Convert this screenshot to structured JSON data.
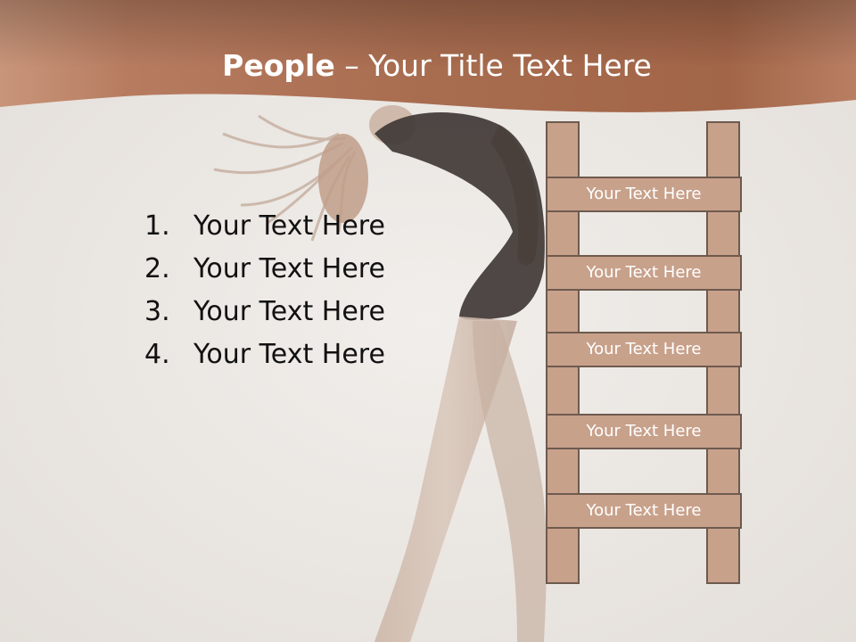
{
  "slide": {
    "title_bold": "People",
    "title_rest": " – Your Title Text Here"
  },
  "list": [
    {
      "number": "1.",
      "text": "Your Text Here"
    },
    {
      "number": "2.",
      "text": "Your Text Here"
    },
    {
      "number": "3.",
      "text": "Your Text Here"
    },
    {
      "number": "4.",
      "text": "Your Text Here"
    }
  ],
  "ladder": {
    "rungs": [
      "Your Text Here",
      "Your Text Here",
      "Your Text Here",
      "Your Text Here",
      "Your Text Here"
    ]
  },
  "colors": {
    "header": "#a86a4e",
    "ladder_fill": "#c8a18b",
    "ladder_border": "#6e5a4e",
    "background": "#ebe7e3"
  }
}
